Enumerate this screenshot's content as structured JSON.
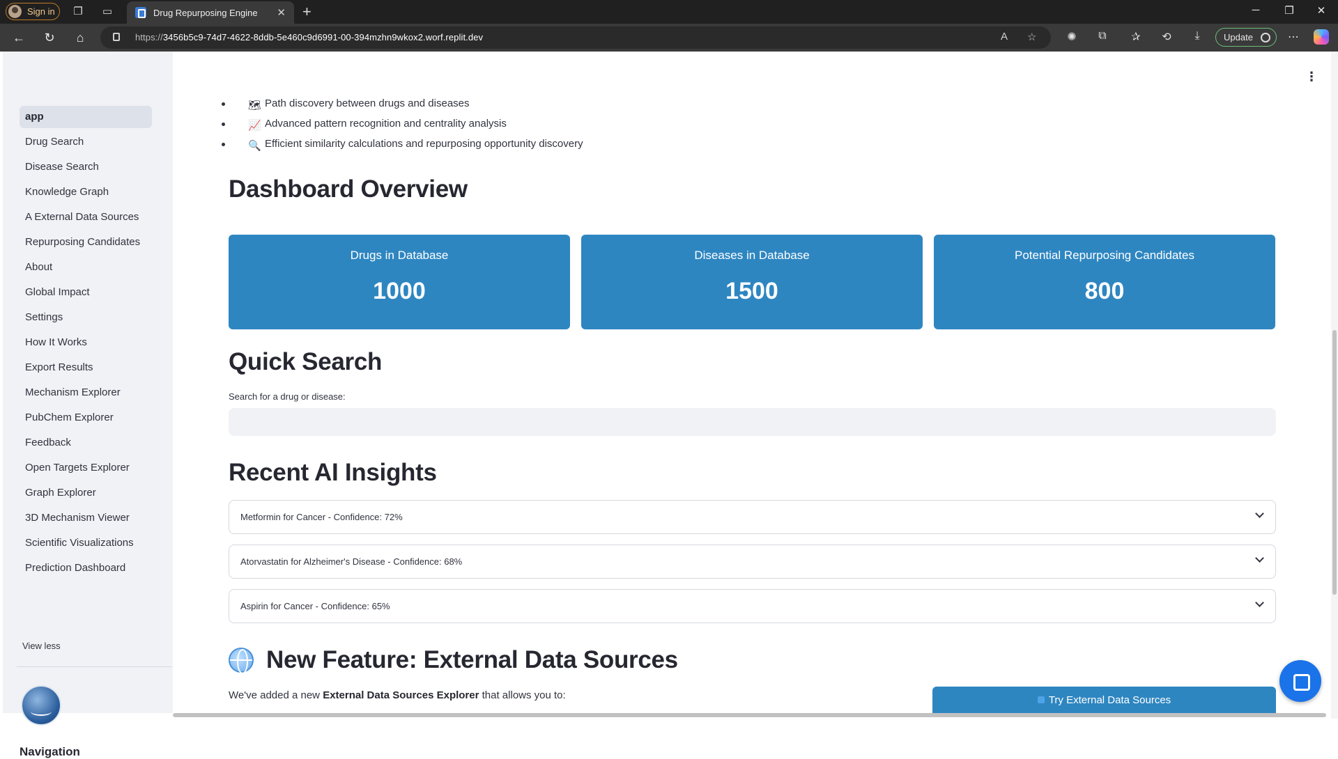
{
  "browser": {
    "signin_label": "Sign in",
    "tab_title": "Drug Repurposing Engine",
    "url_prefix": "https://",
    "url_main": "3456b5c9-74d7-4622-8ddb-5e460c9d6991-00-394mzhn9wkox2.worf.replit.dev",
    "update_label": "Update"
  },
  "sidebar": {
    "items": [
      {
        "label": "app",
        "active": true
      },
      {
        "label": "Drug Search"
      },
      {
        "label": "Disease Search"
      },
      {
        "label": "Knowledge Graph"
      },
      {
        "label": "A External Data Sources"
      },
      {
        "label": "Repurposing Candidates"
      },
      {
        "label": "About"
      },
      {
        "label": "Global Impact"
      },
      {
        "label": "Settings"
      },
      {
        "label": "How It Works"
      },
      {
        "label": "Export Results"
      },
      {
        "label": "Mechanism Explorer"
      },
      {
        "label": "PubChem Explorer"
      },
      {
        "label": "Feedback"
      },
      {
        "label": "Open Targets Explorer"
      },
      {
        "label": "Graph Explorer"
      },
      {
        "label": "3D Mechanism Viewer"
      },
      {
        "label": "Scientific Visualizations"
      },
      {
        "label": "Prediction Dashboard"
      }
    ],
    "view_less": "View less",
    "navigation_title": "Navigation"
  },
  "main": {
    "bullets": [
      {
        "icon": "map-icon",
        "glyph": "🗺",
        "text": "Path discovery between drugs and diseases"
      },
      {
        "icon": "chart-icon",
        "glyph": "📈",
        "text": "Advanced pattern recognition and centrality analysis"
      },
      {
        "icon": "magnifier-icon",
        "glyph": "🔍",
        "text": "Efficient similarity calculations and repurposing opportunity discovery"
      }
    ],
    "dashboard_title": "Dashboard Overview",
    "metrics": [
      {
        "label": "Drugs in Database",
        "value": "1000"
      },
      {
        "label": "Diseases in Database",
        "value": "1500"
      },
      {
        "label": "Potential Repurposing Candidates",
        "value": "800"
      }
    ],
    "quick_search_title": "Quick Search",
    "search_label": "Search for a drug or disease:",
    "search_value": "",
    "insights_title": "Recent AI Insights",
    "insights": [
      "Metformin for Cancer - Confidence: 72%",
      "Atorvastatin for Alzheimer's Disease - Confidence: 68%",
      "Aspirin for Cancer - Confidence: 65%"
    ],
    "new_feature_title": "New Feature: External Data Sources",
    "intro_pre": "We've added a new ",
    "intro_bold": "External Data Sources Explorer",
    "intro_post": " that allows you to:",
    "try_button": "Try External Data Sources"
  },
  "colors": {
    "accent": "#2e86c1",
    "sidebar_bg": "#f0f2f6",
    "text": "#31333f"
  }
}
